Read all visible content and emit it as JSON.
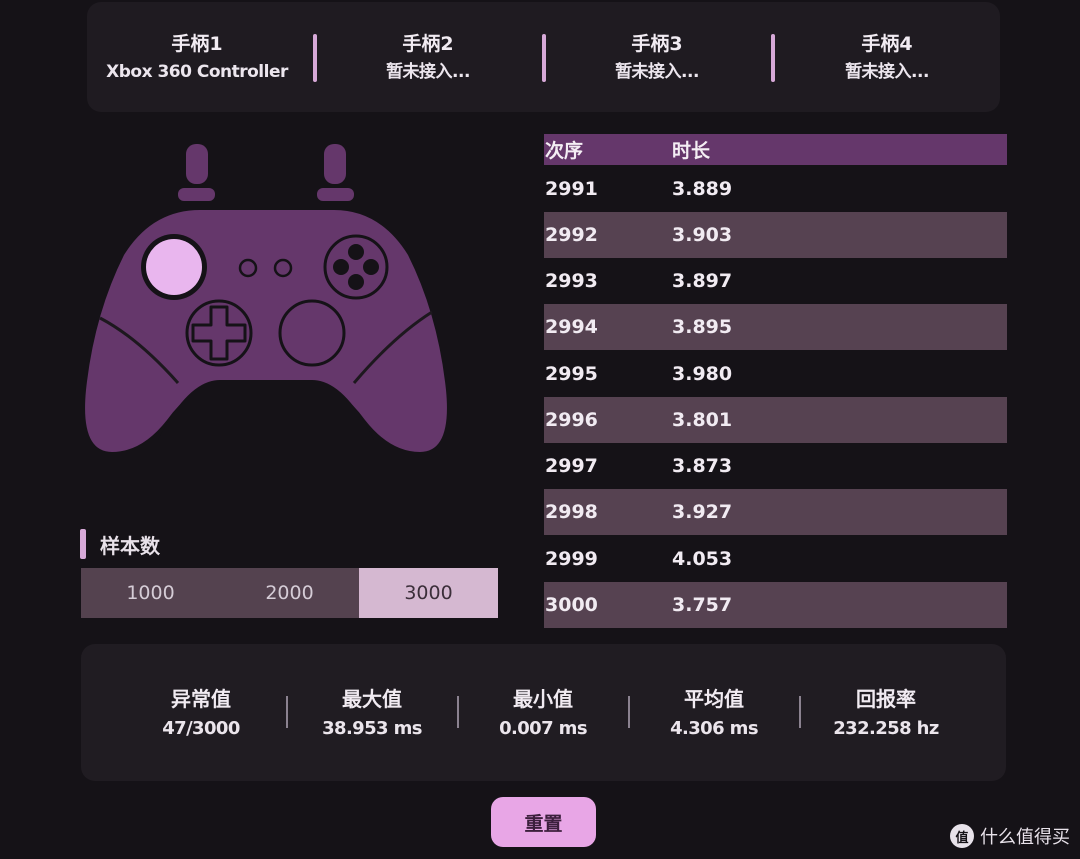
{
  "controllers": [
    {
      "title": "手柄1",
      "subtitle": "Xbox 360 Controller"
    },
    {
      "title": "手柄2",
      "subtitle": "暂未接入..."
    },
    {
      "title": "手柄3",
      "subtitle": "暂未接入..."
    },
    {
      "title": "手柄4",
      "subtitle": "暂未接入..."
    }
  ],
  "samples": {
    "title": "样本数",
    "options": [
      "1000",
      "2000",
      "3000"
    ],
    "selected": "3000"
  },
  "table": {
    "headers": [
      "次序",
      "时长"
    ],
    "rows": [
      [
        "2991",
        "3.889"
      ],
      [
        "2992",
        "3.903"
      ],
      [
        "2993",
        "3.897"
      ],
      [
        "2994",
        "3.895"
      ],
      [
        "2995",
        "3.980"
      ],
      [
        "2996",
        "3.801"
      ],
      [
        "2997",
        "3.873"
      ],
      [
        "2998",
        "3.927"
      ],
      [
        "2999",
        "4.053"
      ],
      [
        "3000",
        "3.757"
      ]
    ]
  },
  "stats": [
    {
      "label": "异常值",
      "value": "47/3000"
    },
    {
      "label": "最大值",
      "value": "38.953 ms"
    },
    {
      "label": "最小值",
      "value": "0.007 ms"
    },
    {
      "label": "平均值",
      "value": "4.306 ms"
    },
    {
      "label": "回报率",
      "value": "232.258 hz"
    }
  ],
  "reset_label": "重置",
  "watermark": {
    "icon_text": "值",
    "text": "什么值得买"
  },
  "colors": {
    "accent": "#d7a9d8",
    "controller_body": "#65376b",
    "active_stick": "#e9b6ee",
    "header_row": "#65376b",
    "alt_row": "#564251",
    "button": "#e8a6e6"
  }
}
